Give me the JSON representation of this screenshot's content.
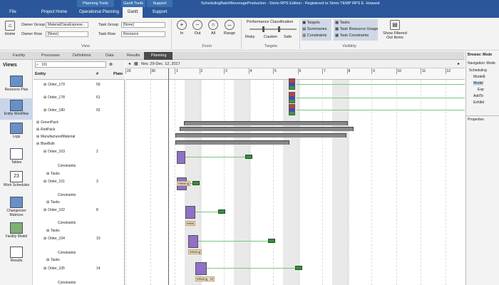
{
  "app": {
    "window_title": "SchedulingBatchBeverageProduction - Simio RPS Edition - Registered to Simio TEMP RPS E. Howard",
    "context_groups": [
      "Planning Tools",
      "Gantt Tools",
      "Support"
    ]
  },
  "ribbon_tabs": [
    "File",
    "Project Home",
    "Operational Planning",
    "Gantt",
    "Support"
  ],
  "ribbon": {
    "home_label": "Home",
    "owner_group_label": "Owner Group",
    "owner_group_value": "MaterialClassExprese...",
    "owner_row_label": "Owner Row",
    "owner_row_value": "[None]",
    "task_group_label": "Task Group",
    "task_group_value": "[None]",
    "task_row_label": "Task Row",
    "task_row_value": "Resource",
    "view_group_label": "View",
    "zoom_buttons": [
      "In",
      "Out",
      "All",
      "Range"
    ],
    "zoom_group_label": "Zoom",
    "perf_title": "Performance Classification",
    "perf_levels": [
      "Risky",
      "Caution",
      "Safe"
    ],
    "targets_group_label": "Targets",
    "visibility_items_left": [
      "Targets",
      "Summaries",
      "Constraints"
    ],
    "visibility_items_right": [
      "Tasks",
      "Task Resource Usage",
      "Task Constraints"
    ],
    "visibility_group_label": "Visibility",
    "filter_button_line1": "Show Filtered",
    "filter_button_line2": "Out Items"
  },
  "doc_tabs": [
    "Facility",
    "Processes",
    "Definitions",
    "Data",
    "Results",
    "Planning"
  ],
  "views": {
    "title": "Views",
    "items": [
      "Resource Plan",
      "Entity Workflow",
      "Logs",
      "Tables",
      "Work Schedules",
      "Changeover Matrices",
      "Facility Model",
      "Results"
    ],
    "calendar_day": "23"
  },
  "entity_grid": {
    "search_value": "101",
    "col_entity": "Entity",
    "col_num": "#",
    "col_plate": "Plate",
    "rows": [
      {
        "label": "Order_179",
        "num": "59"
      },
      {
        "label": "Order_178",
        "num": "61"
      },
      {
        "label": "Order_180",
        "num": "62"
      },
      {
        "label": "GreenPack",
        "num": ""
      },
      {
        "label": "RedPack",
        "num": ""
      },
      {
        "label": "ManufacturedMaterial",
        "num": ""
      },
      {
        "label": "BlueBulk",
        "num": ""
      },
      {
        "label": "Order_103",
        "num": "2"
      },
      {
        "label": "Constraints",
        "num": ""
      },
      {
        "label": "Tasks",
        "num": ""
      },
      {
        "label": "Order_101",
        "num": "3"
      },
      {
        "label": "Constraints",
        "num": ""
      },
      {
        "label": "Tasks",
        "num": ""
      },
      {
        "label": "Order_102",
        "num": "8"
      },
      {
        "label": "Constraints",
        "num": ""
      },
      {
        "label": "Tasks",
        "num": ""
      },
      {
        "label": "Order_104",
        "num": "10"
      },
      {
        "label": "Constraints",
        "num": ""
      },
      {
        "label": "Tasks",
        "num": ""
      },
      {
        "label": "Order_105",
        "num": "14"
      },
      {
        "label": "Constraints",
        "num": ""
      }
    ]
  },
  "gantt": {
    "date_range": "Nov. 29-Dec. 12, 2017",
    "days": [
      "29",
      "30",
      "1",
      "2",
      "3",
      "4",
      "5",
      "6",
      "7",
      "8",
      "9",
      "10",
      "11",
      "12"
    ],
    "labels": [
      "Missing",
      "Missing",
      "Missi",
      "Missing",
      "Missing - M"
    ]
  },
  "right_panel": {
    "browse_title": "Browse: Mode",
    "nav_label": "Navigation: Mode",
    "tree": [
      "Scheduling",
      "ModelE",
      "Model",
      "Exp",
      "AddTo",
      "Exhibit"
    ],
    "properties_title": "Properties"
  }
}
